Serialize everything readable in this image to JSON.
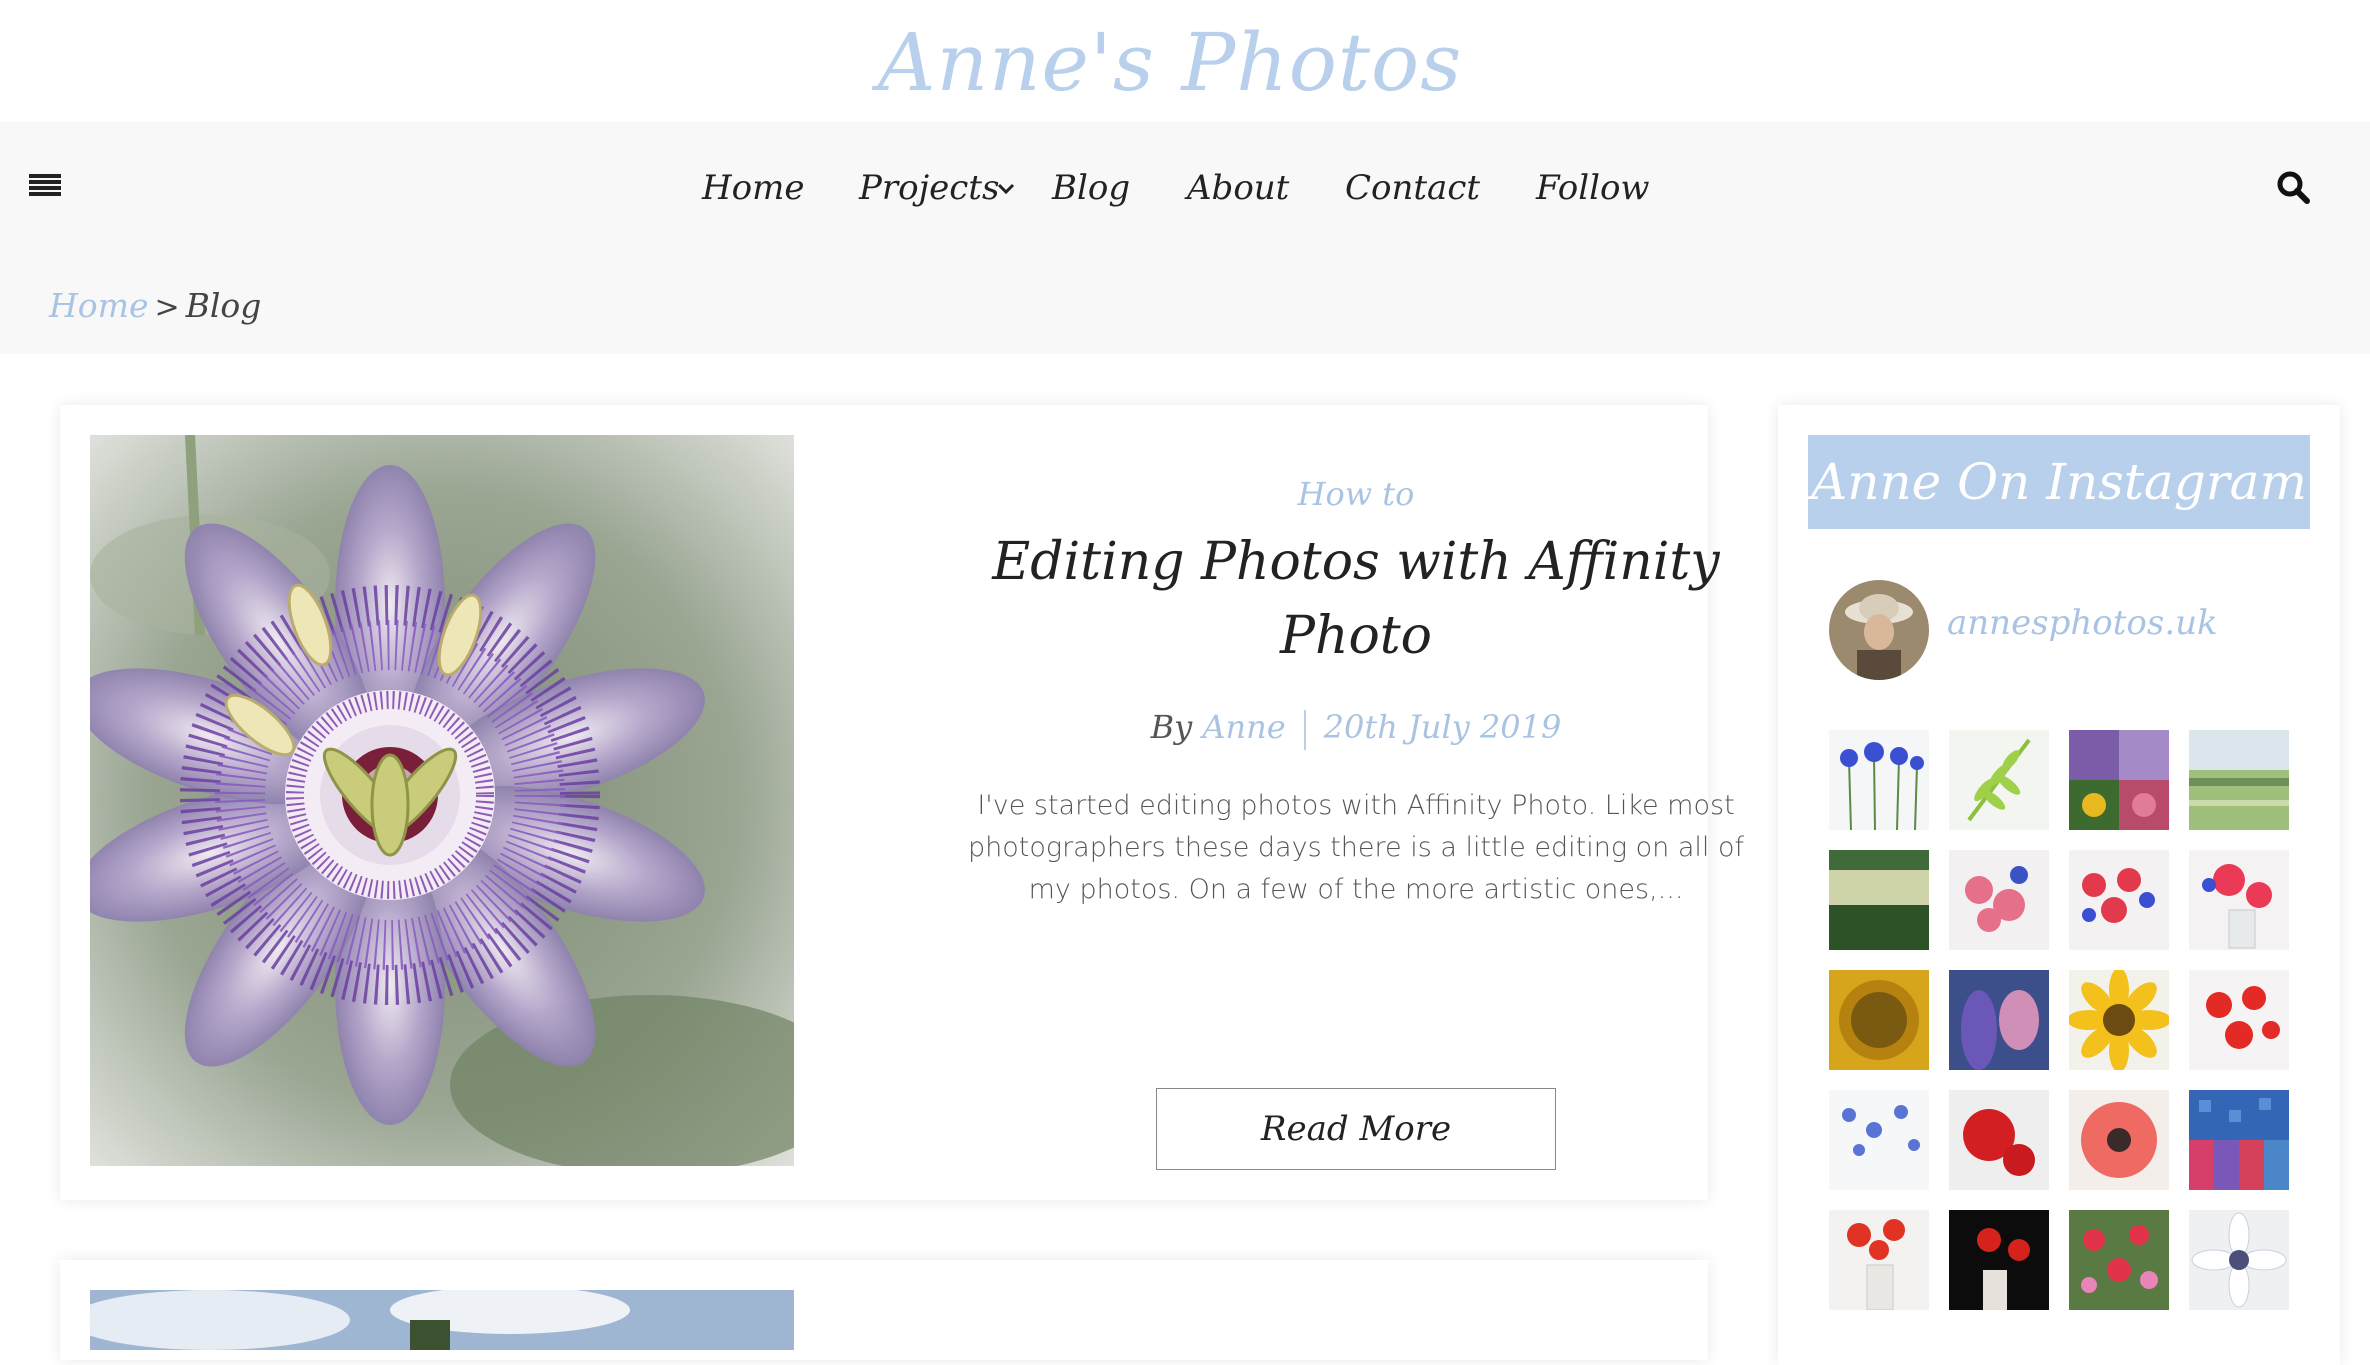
{
  "site": {
    "title": "Anne's Photos"
  },
  "nav": {
    "items": [
      {
        "label": "Home"
      },
      {
        "label": "Projects"
      },
      {
        "label": "Blog"
      },
      {
        "label": "About"
      },
      {
        "label": "Contact"
      },
      {
        "label": "Follow"
      }
    ],
    "menu_icon": "hamburger-icon",
    "search_icon": "search-icon",
    "projects_dropdown_icon": "chevron-down-icon"
  },
  "breadcrumb": {
    "home": "Home",
    "separator": ">",
    "current": "Blog"
  },
  "post": {
    "category": "How to",
    "title": "Editing Photos with Affinity Photo",
    "by": "By",
    "author": "Anne",
    "date": "20th July 2019",
    "excerpt": "I've started editing photos with Affinity Photo. Like most photographers these days there is a little editing on all of my photos. On a few of the more artistic ones,...",
    "read_more": "Read More"
  },
  "sidebar": {
    "widget_title": "Anne On Instagram",
    "profile_name": "annesphotos.uk"
  },
  "colors": {
    "accent": "#a9c4e3",
    "title": "#b8d0eb",
    "nav_bg": "#f8f8f8"
  }
}
